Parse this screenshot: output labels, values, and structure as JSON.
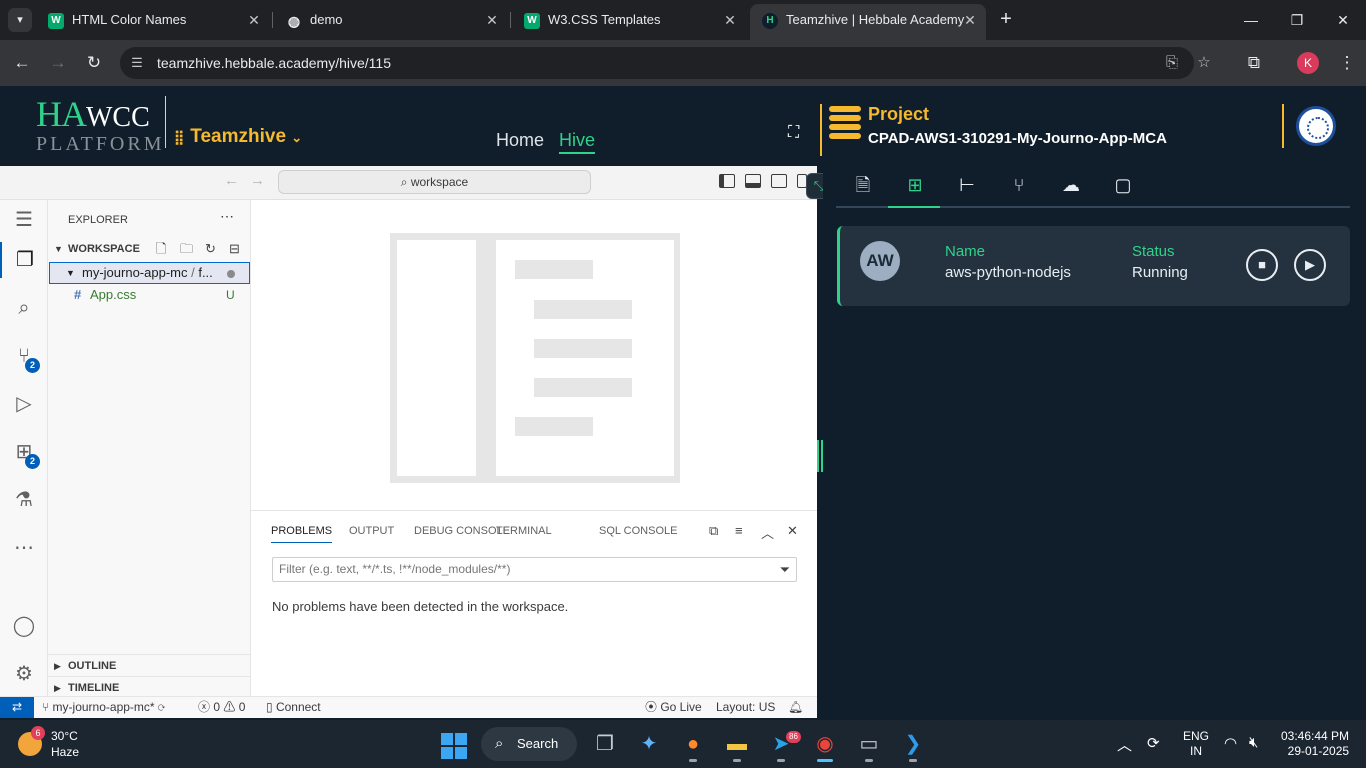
{
  "browser": {
    "tabs": [
      {
        "title": "HTML Color Names",
        "active": false
      },
      {
        "title": "demo",
        "active": false
      },
      {
        "title": "W3.CSS Templates",
        "active": false
      },
      {
        "title": "Teamzhive | Hebbale Academy",
        "active": true
      }
    ],
    "url": "teamzhive.hebbale.academy/hive/115",
    "profile_initial": "K"
  },
  "header": {
    "logo_main": "HA",
    "logo_sub": "WCC",
    "logo_platform": "PLATFORM",
    "team_name": "Teamzhive",
    "nav": {
      "home": "Home",
      "hive": "Hive"
    },
    "project_label": "Project",
    "project_name": "CPAD-AWS1-310291-My-Journo-App-MCA"
  },
  "vscode": {
    "command_center": "workspace",
    "explorer_title": "EXPLORER",
    "workspace_label": "WORKSPACE",
    "folder_name": "my-journo-app-mc",
    "folder_suffix": "f...",
    "file_name": "App.css",
    "file_status": "U",
    "source_control_badge": "2",
    "extensions_badge": "2",
    "outline_label": "OUTLINE",
    "timeline_label": "TIMELINE",
    "panel_tabs": [
      "PROBLEMS",
      "OUTPUT",
      "DEBUG CONSOLE",
      "TERMINAL",
      "SQL CONSOLE"
    ],
    "filter_placeholder": "Filter (e.g. text, **/*.ts, !**/node_modules/**)",
    "problems_message": "No problems have been detected in the workspace.",
    "status": {
      "branch": "my-journo-app-mc*",
      "errors": "0",
      "warnings": "0",
      "connect": "Connect",
      "go_live": "Go Live",
      "layout": "Layout: US"
    }
  },
  "right_panel": {
    "tabs": [
      "file-icon",
      "dashboard-icon",
      "tree-icon",
      "git-icon",
      "cloud-icon",
      "chat-icon"
    ],
    "active_tab": "dashboard-icon",
    "card": {
      "avatar": "AW",
      "name_label": "Name",
      "name_value": "aws-python-nodejs",
      "status_label": "Status",
      "status_value": "Running"
    }
  },
  "taskbar": {
    "weather_temp": "30°C",
    "weather_desc": "Haze",
    "weather_badge": "6",
    "search_label": "Search",
    "telegram_badge": "86",
    "lang_line1": "ENG",
    "lang_line2": "IN",
    "time": "03:46:44 PM",
    "date": "29-01-2025"
  },
  "colors": {
    "accent_green": "#2fd28a",
    "accent_gold": "#f5b82e",
    "app_bg": "#0f1e2a",
    "vscode_blue": "#005fb8"
  }
}
